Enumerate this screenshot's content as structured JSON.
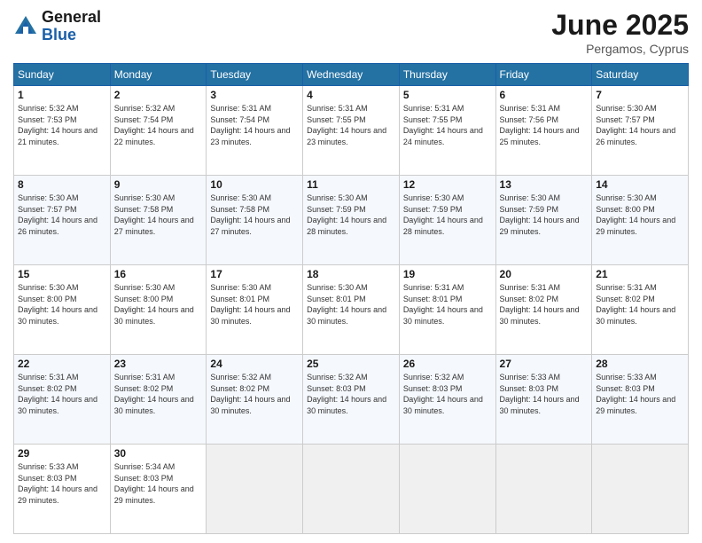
{
  "header": {
    "logo_general": "General",
    "logo_blue": "Blue",
    "month_title": "June 2025",
    "location": "Pergamos, Cyprus"
  },
  "days_of_week": [
    "Sunday",
    "Monday",
    "Tuesday",
    "Wednesday",
    "Thursday",
    "Friday",
    "Saturday"
  ],
  "weeks": [
    [
      {
        "day": "1",
        "sunrise": "5:32 AM",
        "sunset": "7:53 PM",
        "daylight": "14 hours and 21 minutes."
      },
      {
        "day": "2",
        "sunrise": "5:32 AM",
        "sunset": "7:54 PM",
        "daylight": "14 hours and 22 minutes."
      },
      {
        "day": "3",
        "sunrise": "5:31 AM",
        "sunset": "7:54 PM",
        "daylight": "14 hours and 23 minutes."
      },
      {
        "day": "4",
        "sunrise": "5:31 AM",
        "sunset": "7:55 PM",
        "daylight": "14 hours and 23 minutes."
      },
      {
        "day": "5",
        "sunrise": "5:31 AM",
        "sunset": "7:55 PM",
        "daylight": "14 hours and 24 minutes."
      },
      {
        "day": "6",
        "sunrise": "5:31 AM",
        "sunset": "7:56 PM",
        "daylight": "14 hours and 25 minutes."
      },
      {
        "day": "7",
        "sunrise": "5:30 AM",
        "sunset": "7:57 PM",
        "daylight": "14 hours and 26 minutes."
      }
    ],
    [
      {
        "day": "8",
        "sunrise": "5:30 AM",
        "sunset": "7:57 PM",
        "daylight": "14 hours and 26 minutes."
      },
      {
        "day": "9",
        "sunrise": "5:30 AM",
        "sunset": "7:58 PM",
        "daylight": "14 hours and 27 minutes."
      },
      {
        "day": "10",
        "sunrise": "5:30 AM",
        "sunset": "7:58 PM",
        "daylight": "14 hours and 27 minutes."
      },
      {
        "day": "11",
        "sunrise": "5:30 AM",
        "sunset": "7:59 PM",
        "daylight": "14 hours and 28 minutes."
      },
      {
        "day": "12",
        "sunrise": "5:30 AM",
        "sunset": "7:59 PM",
        "daylight": "14 hours and 28 minutes."
      },
      {
        "day": "13",
        "sunrise": "5:30 AM",
        "sunset": "7:59 PM",
        "daylight": "14 hours and 29 minutes."
      },
      {
        "day": "14",
        "sunrise": "5:30 AM",
        "sunset": "8:00 PM",
        "daylight": "14 hours and 29 minutes."
      }
    ],
    [
      {
        "day": "15",
        "sunrise": "5:30 AM",
        "sunset": "8:00 PM",
        "daylight": "14 hours and 30 minutes."
      },
      {
        "day": "16",
        "sunrise": "5:30 AM",
        "sunset": "8:00 PM",
        "daylight": "14 hours and 30 minutes."
      },
      {
        "day": "17",
        "sunrise": "5:30 AM",
        "sunset": "8:01 PM",
        "daylight": "14 hours and 30 minutes."
      },
      {
        "day": "18",
        "sunrise": "5:30 AM",
        "sunset": "8:01 PM",
        "daylight": "14 hours and 30 minutes."
      },
      {
        "day": "19",
        "sunrise": "5:31 AM",
        "sunset": "8:01 PM",
        "daylight": "14 hours and 30 minutes."
      },
      {
        "day": "20",
        "sunrise": "5:31 AM",
        "sunset": "8:02 PM",
        "daylight": "14 hours and 30 minutes."
      },
      {
        "day": "21",
        "sunrise": "5:31 AM",
        "sunset": "8:02 PM",
        "daylight": "14 hours and 30 minutes."
      }
    ],
    [
      {
        "day": "22",
        "sunrise": "5:31 AM",
        "sunset": "8:02 PM",
        "daylight": "14 hours and 30 minutes."
      },
      {
        "day": "23",
        "sunrise": "5:31 AM",
        "sunset": "8:02 PM",
        "daylight": "14 hours and 30 minutes."
      },
      {
        "day": "24",
        "sunrise": "5:32 AM",
        "sunset": "8:02 PM",
        "daylight": "14 hours and 30 minutes."
      },
      {
        "day": "25",
        "sunrise": "5:32 AM",
        "sunset": "8:03 PM",
        "daylight": "14 hours and 30 minutes."
      },
      {
        "day": "26",
        "sunrise": "5:32 AM",
        "sunset": "8:03 PM",
        "daylight": "14 hours and 30 minutes."
      },
      {
        "day": "27",
        "sunrise": "5:33 AM",
        "sunset": "8:03 PM",
        "daylight": "14 hours and 30 minutes."
      },
      {
        "day": "28",
        "sunrise": "5:33 AM",
        "sunset": "8:03 PM",
        "daylight": "14 hours and 29 minutes."
      }
    ],
    [
      {
        "day": "29",
        "sunrise": "5:33 AM",
        "sunset": "8:03 PM",
        "daylight": "14 hours and 29 minutes."
      },
      {
        "day": "30",
        "sunrise": "5:34 AM",
        "sunset": "8:03 PM",
        "daylight": "14 hours and 29 minutes."
      },
      null,
      null,
      null,
      null,
      null
    ]
  ]
}
